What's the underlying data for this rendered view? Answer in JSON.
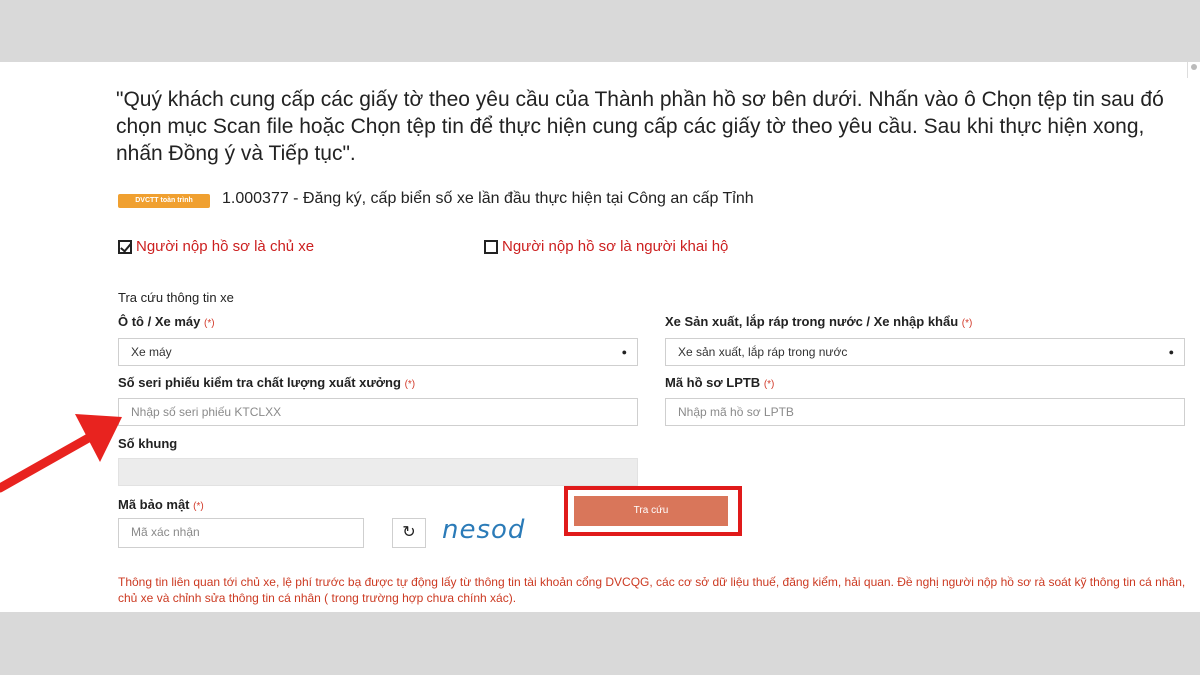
{
  "intro_text": "\"Quý khách cung cấp các giấy tờ theo yêu cầu của Thành phần hồ sơ bên dưới. Nhấn vào ô Chọn tệp tin sau đó chọn mục Scan file hoặc Chọn tệp tin để thực hiện cung cấp các giấy tờ theo yêu cầu. Sau khi thực hiện xong, nhấn Đồng ý và Tiếp tục\".",
  "procedure": {
    "badge": "DVCTT toàn trình",
    "code": "1.000377",
    "name": " - Đăng ký, cấp biển số xe lần đầu thực hiện tại Công an cấp Tỉnh"
  },
  "options": {
    "owner_label": "Người nộp hồ sơ là chủ xe",
    "declarant_label": "Người nộp hồ sơ là người khai hộ"
  },
  "form": {
    "section_title": "Tra cứu thông tin xe",
    "required_mark": "(*)",
    "vehicle_type": {
      "label": "Ô tô / Xe máy",
      "value": "Xe máy"
    },
    "origin": {
      "label": "Xe Sản xuất, lắp ráp trong nước / Xe nhập khẩu",
      "value": "Xe sản xuất, lắp ráp trong nước"
    },
    "serial": {
      "label": "Số seri phiếu kiểm tra chất lượng xuất xưởng",
      "placeholder": "Nhập số seri phiếu KTCLXX"
    },
    "lptb": {
      "label": "Mã hồ sơ LPTB",
      "placeholder": "Nhập mã hồ sơ LPTB"
    },
    "frame": {
      "label": "Số khung"
    },
    "security": {
      "label": "Mã bảo mật",
      "placeholder": "Mã xác nhận",
      "captcha": "nesod"
    },
    "lookup_button": "Tra cứu"
  },
  "note": "Thông tin liên quan tới chủ xe, lệ phí trước bạ được tự động lấy từ thông tin tài khoản cổng DVCQG, các cơ sở dữ liệu thuế, đăng kiểm, hải quan. Đề nghị người nộp hồ sơ rà soát kỹ thông tin cá nhân, chủ xe và chỉnh sửa thông tin cá nhân ( trong trường hợp chưa chính xác).",
  "colors": {
    "accent_red": "#e01a1a",
    "button": "#d9765a",
    "badge": "#f0a030",
    "note_text": "#cc3a22"
  },
  "icons": {
    "refresh": "refresh-icon",
    "dropdown": "caret-down-icon",
    "annotation_arrow": "red-arrow-icon"
  }
}
